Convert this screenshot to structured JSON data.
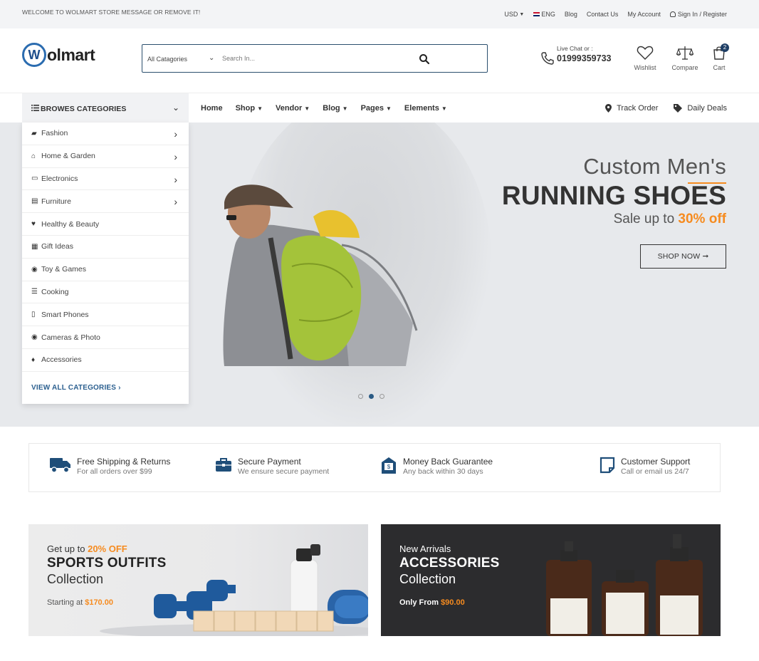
{
  "topbar": {
    "welcome": "WELCOME TO WOLMART STORE MESSAGE OR REMOVE IT!",
    "currency": "USD",
    "language": "ENG",
    "links": [
      "Blog",
      "Contact Us",
      "My Account"
    ],
    "signin": "Sign In",
    "separator": "/",
    "register": "Register"
  },
  "header": {
    "logo_letter": "W",
    "logo_text": "olmart",
    "search_category": "All Catagories",
    "search_placeholder": "Search In...",
    "chat_label": "Live Chat or :",
    "phone": "01999359733",
    "wishlist": "Wishlist",
    "compare": "Compare",
    "cart": "Cart",
    "cart_count": "2"
  },
  "nav": {
    "browse": "BROWES CATEGORIES",
    "items": [
      "Home",
      "Shop",
      "Vendor",
      "Blog",
      "Pages",
      "Elements"
    ],
    "track_order": "Track Order",
    "daily_deals": "Daily Deals"
  },
  "categories": [
    {
      "label": "Fashion",
      "icon": "tshirt-icon",
      "arrow": true
    },
    {
      "label": "Home & Garden",
      "icon": "home-icon",
      "arrow": true
    },
    {
      "label": "Electronics",
      "icon": "monitor-icon",
      "arrow": true
    },
    {
      "label": "Furniture",
      "icon": "bed-icon",
      "arrow": true
    },
    {
      "label": "Healthy & Beauty",
      "icon": "heart-icon",
      "arrow": false
    },
    {
      "label": "Gift Ideas",
      "icon": "gift-icon",
      "arrow": false
    },
    {
      "label": "Toy & Games",
      "icon": "gamepad-icon",
      "arrow": false
    },
    {
      "label": "Cooking",
      "icon": "hamburger-icon",
      "arrow": false
    },
    {
      "label": "Smart Phones",
      "icon": "mobile-icon",
      "arrow": false
    },
    {
      "label": "Cameras & Photo",
      "icon": "camera-icon",
      "arrow": false
    },
    {
      "label": "Accessories",
      "icon": "gem-icon",
      "arrow": false
    }
  ],
  "view_all": "VIEW ALL CATEGORIES",
  "hero": {
    "subtitle": "Custom Men's",
    "title": "RUNNING SHOES",
    "sale_prefix": "Sale up to ",
    "sale_highlight": "30% off",
    "button": "SHOP NOW",
    "slides": 3,
    "active_slide": 2
  },
  "features": [
    {
      "title": "Free Shipping & Returns",
      "sub": "For all orders over $99",
      "icon": "truck-icon"
    },
    {
      "title": "Secure Payment",
      "sub": "We ensure secure payment",
      "icon": "briefcase-icon"
    },
    {
      "title": "Money Back Guarantee",
      "sub": "Any back within 30 days",
      "icon": "money-back-icon"
    },
    {
      "title": "Customer Support",
      "sub": "Call or email us 24/7",
      "icon": "support-icon"
    }
  ],
  "banners": [
    {
      "pre": "Get up to ",
      "pre_highlight": "20% OFF",
      "title": "SPORTS OUTFITS",
      "collection": "Collection",
      "start_prefix": "Starting at ",
      "price": "$170.00"
    },
    {
      "pre": "New Arrivals",
      "title": "ACCESSORIES",
      "collection": "Collection",
      "start_prefix": "Only From ",
      "price": "$90.00"
    }
  ],
  "colors": {
    "accent": "#f68b1f",
    "brand": "#2b5f8f",
    "dark": "#333333"
  }
}
